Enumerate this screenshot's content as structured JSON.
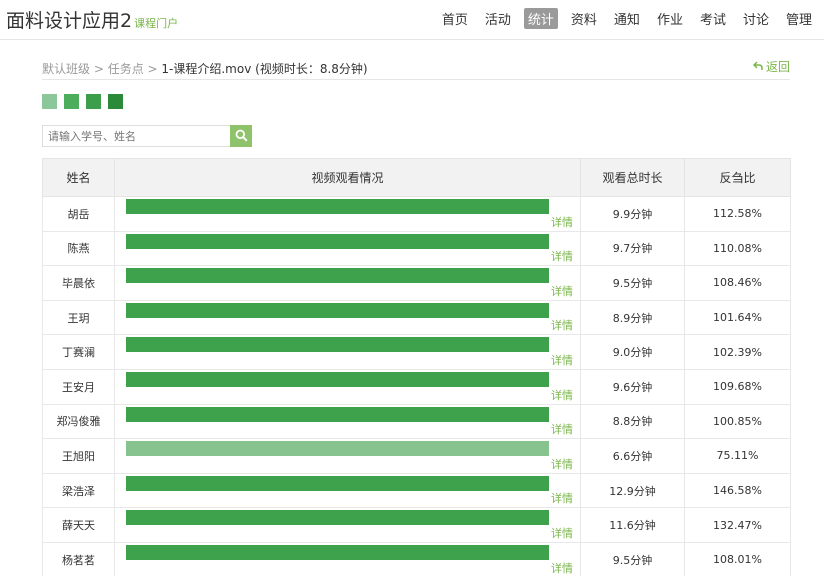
{
  "header": {
    "course_title": "面料设计应用2",
    "course_portal": "课程门户",
    "nav": [
      "首页",
      "活动",
      "统计",
      "资料",
      "通知",
      "作业",
      "考试",
      "讨论",
      "管理"
    ],
    "active_nav": "统计"
  },
  "breadcrumb": {
    "class": "默认班级",
    "sep1": " > ",
    "task": "任务点",
    "sep2": " > ",
    "current": "1-课程介绍.mov  (视频时长：8.8分钟)"
  },
  "back_label": "返回",
  "legend_colors": [
    "#8cc79b",
    "#4cae5c",
    "#3c9d4b",
    "#2b8a3a"
  ],
  "search": {
    "placeholder": "请输入学号、姓名"
  },
  "table": {
    "headers": [
      "姓名",
      "视频观看情况",
      "观看总时长",
      "反刍比"
    ],
    "detail_label": "详情",
    "rows": [
      {
        "name": "胡岳",
        "watch_fraction": 1.0,
        "bar_color": "#3da24b",
        "duration": "9.9分钟",
        "ratio": "112.58%"
      },
      {
        "name": "陈燕",
        "watch_fraction": 1.0,
        "bar_color": "#3da24b",
        "duration": "9.7分钟",
        "ratio": "110.08%"
      },
      {
        "name": "毕晨依",
        "watch_fraction": 1.0,
        "bar_color": "#3da24b",
        "duration": "9.5分钟",
        "ratio": "108.46%"
      },
      {
        "name": "王玥",
        "watch_fraction": 1.0,
        "bar_color": "#3da24b",
        "duration": "8.9分钟",
        "ratio": "101.64%"
      },
      {
        "name": "丁赛澜",
        "watch_fraction": 1.0,
        "bar_color": "#3da24b",
        "duration": "9.0分钟",
        "ratio": "102.39%"
      },
      {
        "name": "王安月",
        "watch_fraction": 1.0,
        "bar_color": "#3da24b",
        "duration": "9.6分钟",
        "ratio": "109.68%"
      },
      {
        "name": "郑冯俊雅",
        "watch_fraction": 1.0,
        "bar_color": "#3da24b",
        "duration": "8.8分钟",
        "ratio": "100.85%"
      },
      {
        "name": "王旭阳",
        "watch_fraction": 1.0,
        "bar_color": "#86c38f",
        "duration": "6.6分钟",
        "ratio": "75.11%"
      },
      {
        "name": "梁浩泽",
        "watch_fraction": 1.0,
        "bar_color": "#3da24b",
        "duration": "12.9分钟",
        "ratio": "146.58%"
      },
      {
        "name": "薛天天",
        "watch_fraction": 1.0,
        "bar_color": "#3da24b",
        "duration": "11.6分钟",
        "ratio": "132.47%"
      },
      {
        "name": "杨茗茗",
        "watch_fraction": 1.0,
        "bar_color": "#3da24b",
        "duration": "9.5分钟",
        "ratio": "108.01%"
      }
    ]
  }
}
